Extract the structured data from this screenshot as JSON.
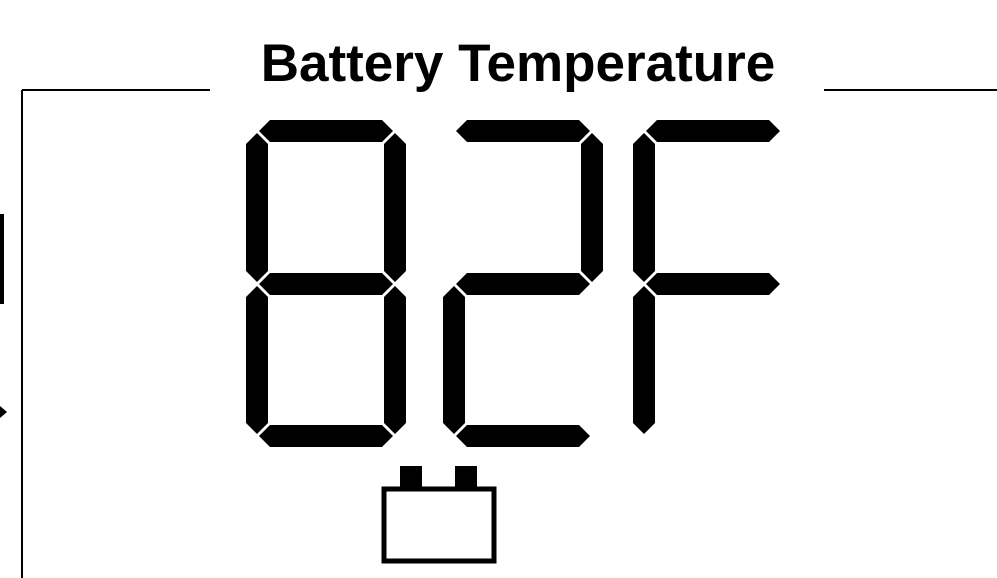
{
  "title": "Battery Temperature",
  "display": {
    "digits": [
      "8",
      "2",
      "F"
    ],
    "status_icon": "battery-icon"
  },
  "colors": {
    "segment": "#000000",
    "background": "#ffffff",
    "frame": "#000000"
  }
}
